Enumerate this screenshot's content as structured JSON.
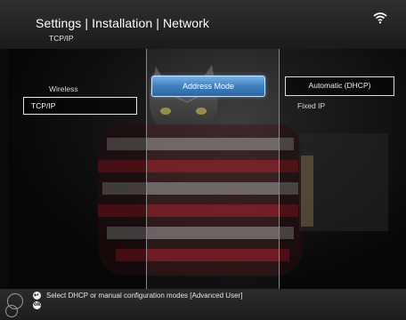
{
  "header": {
    "title": "Settings | Installation | Network",
    "subtitle": "TCP/IP",
    "status_icon": "wifi-signal-icon"
  },
  "left_menu": {
    "items": [
      "Wireless",
      "TCP/IP"
    ],
    "selected": "TCP/IP"
  },
  "middle_menu": {
    "items": [
      "Address Mode"
    ],
    "selected": "Address Mode"
  },
  "right_menu": {
    "items": [
      "Automatic (DHCP)",
      "Fixed IP"
    ],
    "highlighted": "Automatic (DHCP)"
  },
  "footer": {
    "hint": "Select DHCP or manual configuration modes [Advanced User]",
    "icons": [
      "back-button-icon",
      "ok-button-icon",
      "navigation-wheel-icon"
    ]
  },
  "colors": {
    "selection_blue": "#3f7fbf",
    "text_white": "#ffffff",
    "divider_grey": "#8a8a8a"
  }
}
